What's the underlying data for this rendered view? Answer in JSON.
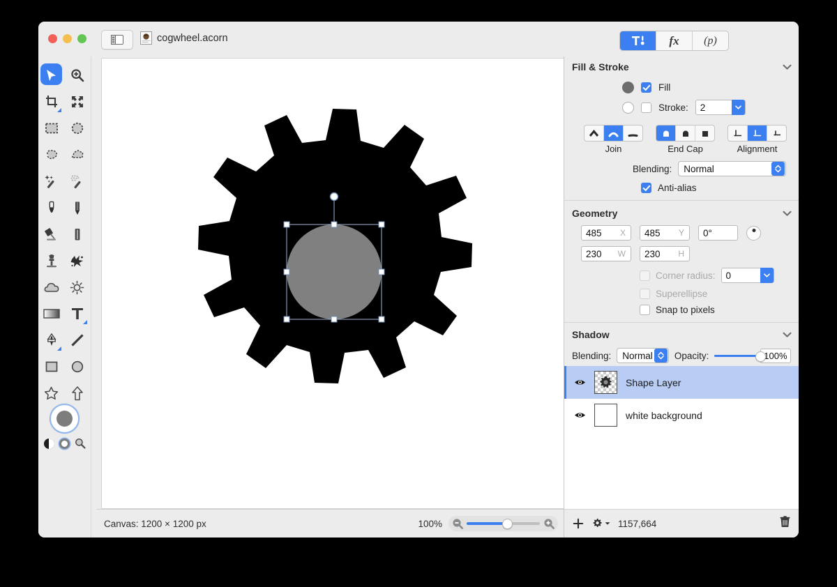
{
  "window": {
    "document_title": "cogwheel.acorn",
    "traffic_lights": [
      "close",
      "minimize",
      "zoom"
    ],
    "sidebar_toggle_icon": "sidebar-toggle-icon",
    "doc_icon": "acorn-document-icon",
    "segmented": [
      {
        "id": "tools",
        "label": "",
        "icon": "hammer-tools-icon",
        "selected": true
      },
      {
        "id": "fx",
        "label": "fx",
        "icon": "fx-icon",
        "selected": false
      },
      {
        "id": "palette",
        "label": "(p)",
        "icon": "palette-icon",
        "selected": false
      }
    ]
  },
  "toolbar": {
    "tools": [
      {
        "name": "move-tool",
        "icon": "cursor-arrow-icon",
        "selected": true,
        "submenu": false
      },
      {
        "name": "zoom-tool",
        "icon": "magnifier-plus-icon",
        "selected": false,
        "submenu": false
      },
      {
        "name": "crop-tool",
        "icon": "crop-icon",
        "selected": false,
        "submenu": true
      },
      {
        "name": "transform-tool",
        "icon": "move-arrows-icon",
        "selected": false,
        "submenu": false
      },
      {
        "name": "rectangular-select-tool",
        "icon": "marquee-rect-icon",
        "selected": false,
        "submenu": false
      },
      {
        "name": "elliptical-select-tool",
        "icon": "marquee-ellipse-icon",
        "selected": false,
        "submenu": false
      },
      {
        "name": "lasso-tool",
        "icon": "lasso-icon",
        "selected": false,
        "submenu": false
      },
      {
        "name": "polygon-select-tool",
        "icon": "polygon-lasso-icon",
        "selected": false,
        "submenu": false
      },
      {
        "name": "magic-wand-tool",
        "icon": "magic-wand-icon",
        "selected": false,
        "submenu": false
      },
      {
        "name": "instant-alpha-tool",
        "icon": "instant-alpha-icon",
        "selected": false,
        "submenu": false
      },
      {
        "name": "paintbrush-tool",
        "icon": "paintbrush-icon",
        "selected": false,
        "submenu": false
      },
      {
        "name": "pencil-tool",
        "icon": "pencil-icon",
        "selected": false,
        "submenu": false
      },
      {
        "name": "paint-bucket-tool",
        "icon": "paint-bucket-icon",
        "selected": false,
        "submenu": false
      },
      {
        "name": "eraser-tool",
        "icon": "eraser-icon",
        "selected": false,
        "submenu": false
      },
      {
        "name": "clone-stamp-tool",
        "icon": "clone-stamp-icon",
        "selected": false,
        "submenu": false
      },
      {
        "name": "smudge-tool",
        "icon": "smudge-splatter-icon",
        "selected": false,
        "submenu": false
      },
      {
        "name": "blur-tool",
        "icon": "cloud-blur-icon",
        "selected": false,
        "submenu": false
      },
      {
        "name": "dodge-burn-tool",
        "icon": "sun-dodge-icon",
        "selected": false,
        "submenu": false
      },
      {
        "name": "gradient-tool",
        "icon": "gradient-icon",
        "selected": false,
        "submenu": false
      },
      {
        "name": "text-tool",
        "icon": "text-t-icon",
        "selected": false,
        "submenu": true
      },
      {
        "name": "bezier-pen-tool",
        "icon": "pen-nib-icon",
        "selected": false,
        "submenu": true
      },
      {
        "name": "line-tool",
        "icon": "line-icon",
        "selected": false,
        "submenu": false
      },
      {
        "name": "rectangle-tool",
        "icon": "rectangle-icon",
        "selected": false,
        "submenu": false
      },
      {
        "name": "ellipse-tool",
        "icon": "ellipse-icon",
        "selected": false,
        "submenu": false
      },
      {
        "name": "star-tool",
        "icon": "star-icon",
        "selected": false,
        "submenu": false
      },
      {
        "name": "arrow-tool",
        "icon": "arrow-up-icon",
        "selected": false,
        "submenu": false
      }
    ],
    "color_well": {
      "fill_color": "#7d7d7d",
      "swap_icon": "swap-colors-icon",
      "reset_icon": "reset-colors-icon",
      "picker_icon": "color-picker-magnifier-icon"
    }
  },
  "canvas": {
    "status_label": "Canvas: 1200 × 1200 px",
    "zoom_percent": "100%",
    "zoom_out_icon": "magnifier-minus-icon",
    "zoom_in_icon": "magnifier-plus-icon",
    "artwork": {
      "gear_color": "#000000",
      "gear_teeth": 12,
      "circle_color": "#808080",
      "selection_handles": 8,
      "rotation_handle": true
    }
  },
  "inspector": {
    "fill_stroke": {
      "title": "Fill & Stroke",
      "collapse_icon": "chevron-down-icon",
      "fill": {
        "label": "Fill",
        "checked": true,
        "swatch_color": "#6d6d6d"
      },
      "stroke": {
        "label": "Stroke:",
        "checked": false,
        "width": "2",
        "swatch_color": "#ffffff"
      },
      "join": {
        "label": "Join",
        "options": [
          "miter",
          "round",
          "bevel"
        ],
        "selected_index": 1
      },
      "end_cap": {
        "label": "End Cap",
        "options": [
          "round",
          "square",
          "butt"
        ],
        "selected_index": 0
      },
      "alignment": {
        "label": "Alignment",
        "options": [
          "inside",
          "center",
          "outside"
        ],
        "selected_index": 1
      },
      "blending": {
        "label": "Blending:",
        "value": "Normal"
      },
      "anti_alias": {
        "label": "Anti-alias",
        "checked": true
      }
    },
    "geometry": {
      "title": "Geometry",
      "collapse_icon": "chevron-down-icon",
      "x": {
        "value": "485",
        "suffix": "X"
      },
      "y": {
        "value": "485",
        "suffix": "Y"
      },
      "rotation": {
        "value": "0°"
      },
      "w": {
        "value": "230",
        "suffix": "W"
      },
      "h": {
        "value": "230",
        "suffix": "H"
      },
      "corner_radius": {
        "label": "Corner radius:",
        "value": "0",
        "checked": false,
        "enabled": false
      },
      "superellipse": {
        "label": "Superellipse",
        "checked": false,
        "enabled": false
      },
      "snap_to_pixels": {
        "label": "Snap to pixels",
        "checked": false,
        "enabled": true
      }
    },
    "shadow": {
      "title": "Shadow",
      "collapse_icon": "chevron-down-icon"
    },
    "layer_controls": {
      "blending_label": "Blending:",
      "blending_value": "Normal",
      "opacity_label": "Opacity:",
      "opacity_value": "100%",
      "opacity_percent": 100
    },
    "layers": [
      {
        "name": "Shape Layer",
        "visible": true,
        "selected": true,
        "thumb": "gear-thumbnail",
        "eye_icon": "eye-icon"
      },
      {
        "name": "white background",
        "visible": true,
        "selected": false,
        "thumb": "white-thumbnail",
        "eye_icon": "eye-icon"
      }
    ],
    "layer_toolbar": {
      "add_icon": "plus-icon",
      "actions_icon": "gear-dropdown-icon",
      "coordinates": "1157,664",
      "delete_icon": "trash-icon"
    }
  },
  "colors": {
    "accent": "#3b7ff0",
    "window_bg": "#ececec",
    "selection_row": "#b9cdf4"
  }
}
